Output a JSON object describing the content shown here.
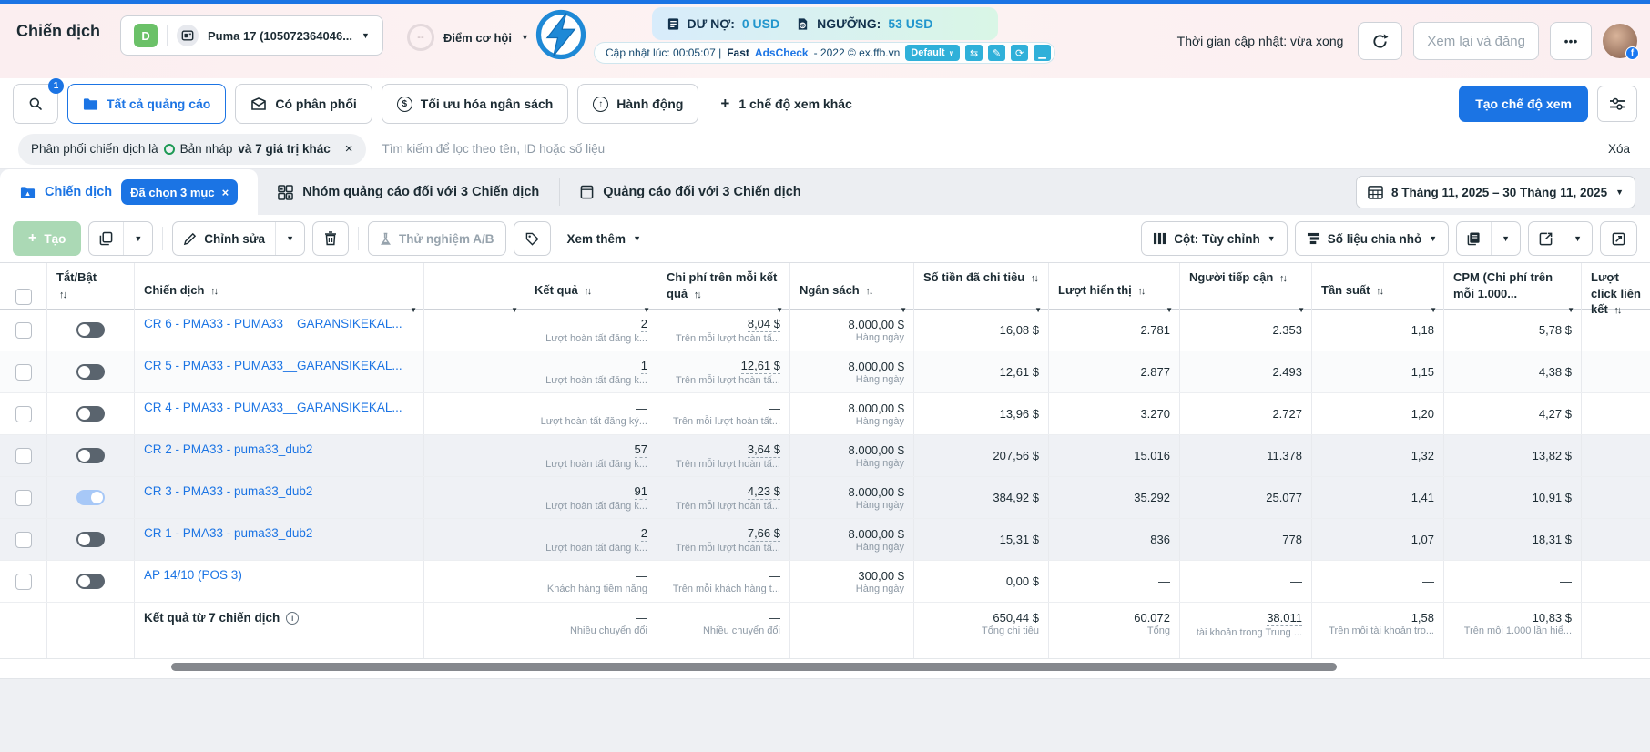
{
  "topbar": {
    "page_title": "Chiến dịch",
    "account_badge": "D",
    "account_name": "Puma 17 (105072364046...",
    "opportunity_score": "--",
    "opportunity_label": "Điểm cơ hội",
    "debt_label": "DƯ NỢ:",
    "debt_value": "0 USD",
    "threshold_label": "NGƯỠNG:",
    "threshold_value": "53 USD",
    "adscheck_updated": "Cập nhật lúc: 00:05:07 |",
    "adscheck_fast": "Fast",
    "adscheck_brand": "AdsCheck",
    "adscheck_suffix": "- 2022 © ex.ffb.vn",
    "default_button": "Default",
    "refresh_time": "Thời gian cập nhật: vừa xong",
    "review_button": "Xem lại và đăng",
    "more_button": "•••"
  },
  "views_bar": {
    "search_badge": "1",
    "tab_all": "Tất cả quảng cáo",
    "tab_delivery": "Có phân phối",
    "tab_budget": "Tối ưu hóa ngân sách",
    "tab_action": "Hành động",
    "more_views": "1 chế độ xem khác",
    "create_view_button": "Tạo chế độ xem"
  },
  "filter_bar": {
    "pill_prefix": "Phân phối chiến dịch là",
    "pill_value": "Bản nháp",
    "pill_suffix": "và 7 giá trị khác",
    "search_placeholder": "Tìm kiếm để lọc theo tên, ID hoặc số liệu",
    "clear_label": "Xóa"
  },
  "level_tabs": {
    "campaign_tab": "Chiến dịch",
    "selected_badge": "Đã chọn 3 mục",
    "adset_tab": "Nhóm quảng cáo đối với 3 Chiến dịch",
    "ad_tab": "Quảng cáo đối với 3 Chiến dịch",
    "date_range": "8 Tháng 11, 2025 – 30 Tháng 11, 2025"
  },
  "toolbar": {
    "create": "Tạo",
    "edit": "Chỉnh sửa",
    "ab_test": "Thử nghiệm A/B",
    "see_more": "Xem thêm",
    "columns": "Cột: Tùy chỉnh",
    "breakdown": "Số liệu chia nhỏ"
  },
  "table": {
    "headers": {
      "toggle": "Tắt/Bật",
      "campaign": "Chiến dịch",
      "results": "Kết quả",
      "cost_per_result": "Chi phí trên mỗi kết quả",
      "budget": "Ngân sách",
      "amount_spent": "Số tiền đã chi tiêu",
      "impressions": "Lượt hiển thị",
      "reach": "Người tiếp cận",
      "frequency": "Tần suất",
      "cpm": "CPM (Chi phí trên mỗi 1.000...",
      "link_clicks": "Lượt click liên kết"
    },
    "rows": [
      {
        "name": "CR 6 - PMA33 - PUMA33__GARANSIKEKAL...",
        "toggle_on": false,
        "shade": "",
        "dashed": true,
        "result": "2",
        "result_sub": "Lượt hoàn tất đăng k...",
        "cpr": "8,04 $",
        "cpr_sub": "Trên mỗi lượt hoàn tấ...",
        "budget": "8.000,00 $",
        "budget_sub": "Hàng ngày",
        "spent": "16,08 $",
        "impressions": "2.781",
        "reach": "2.353",
        "frequency": "1,18",
        "cpm": "5,78 $"
      },
      {
        "name": "CR 5 - PMA33 - PUMA33__GARANSIKEKAL...",
        "toggle_on": false,
        "shade": "zebra",
        "dashed": true,
        "result": "1",
        "result_sub": "Lượt hoàn tất đăng k...",
        "cpr": "12,61 $",
        "cpr_sub": "Trên mỗi lượt hoàn tấ...",
        "budget": "8.000,00 $",
        "budget_sub": "Hàng ngày",
        "spent": "12,61 $",
        "impressions": "2.877",
        "reach": "2.493",
        "frequency": "1,15",
        "cpm": "4,38 $"
      },
      {
        "name": "CR 4 - PMA33 - PUMA33__GARANSIKEKAL...",
        "toggle_on": false,
        "shade": "",
        "dashed": false,
        "result": "—",
        "result_sub": "Lượt hoàn tất đăng ký...",
        "cpr": "—",
        "cpr_sub": "Trên mỗi lượt hoàn tất...",
        "budget": "8.000,00 $",
        "budget_sub": "Hàng ngày",
        "spent": "13,96 $",
        "impressions": "3.270",
        "reach": "2.727",
        "frequency": "1,20",
        "cpm": "4,27 $"
      },
      {
        "name": "CR 2 - PMA33 - puma33_dub2",
        "toggle_on": false,
        "shade": "selected",
        "dashed": true,
        "result": "57",
        "result_sub": "Lượt hoàn tất đăng k...",
        "cpr": "3,64 $",
        "cpr_sub": "Trên mỗi lượt hoàn tấ...",
        "budget": "8.000,00 $",
        "budget_sub": "Hàng ngày",
        "spent": "207,56 $",
        "impressions": "15.016",
        "reach": "11.378",
        "frequency": "1,32",
        "cpm": "13,82 $"
      },
      {
        "name": "CR 3 - PMA33 - puma33_dub2",
        "toggle_on": true,
        "shade": "selected",
        "dashed": true,
        "result": "91",
        "result_sub": "Lượt hoàn tất đăng k...",
        "cpr": "4,23 $",
        "cpr_sub": "Trên mỗi lượt hoàn tấ...",
        "budget": "8.000,00 $",
        "budget_sub": "Hàng ngày",
        "spent": "384,92 $",
        "impressions": "35.292",
        "reach": "25.077",
        "frequency": "1,41",
        "cpm": "10,91 $"
      },
      {
        "name": "CR 1 - PMA33 - puma33_dub2",
        "toggle_on": false,
        "shade": "selected",
        "dashed": true,
        "result": "2",
        "result_sub": "Lượt hoàn tất đăng k...",
        "cpr": "7,66 $",
        "cpr_sub": "Trên mỗi lượt hoàn tấ...",
        "budget": "8.000,00 $",
        "budget_sub": "Hàng ngày",
        "spent": "15,31 $",
        "impressions": "836",
        "reach": "778",
        "frequency": "1,07",
        "cpm": "18,31 $"
      },
      {
        "name": "AP 14/10 (POS 3)",
        "toggle_on": false,
        "shade": "",
        "dashed": false,
        "result": "—",
        "result_sub": "Khách hàng tiềm năng",
        "cpr": "—",
        "cpr_sub": "Trên mỗi khách hàng t...",
        "budget": "300,00 $",
        "budget_sub": "Hàng ngày",
        "spent": "0,00 $",
        "impressions": "—",
        "reach": "—",
        "frequency": "—",
        "cpm": "—"
      }
    ],
    "summary": {
      "label": "Kết quả từ 7 chiến dịch",
      "result": "—",
      "result_sub": "Nhiều chuyển đổi",
      "cpr": "—",
      "cpr_sub": "Nhiều chuyển đổi",
      "spent": "650,44 $",
      "spent_sub": "Tổng chi tiêu",
      "impressions": "60.072",
      "impressions_sub": "Tổng",
      "reach": "38.011",
      "reach_sub": "tài khoản trong Trung ...",
      "frequency": "1,58",
      "frequency_sub": "Trên mỗi tài khoản tro...",
      "cpm": "10,83 $",
      "cpm_sub": "Trên mỗi 1.000 lần hiể..."
    }
  }
}
